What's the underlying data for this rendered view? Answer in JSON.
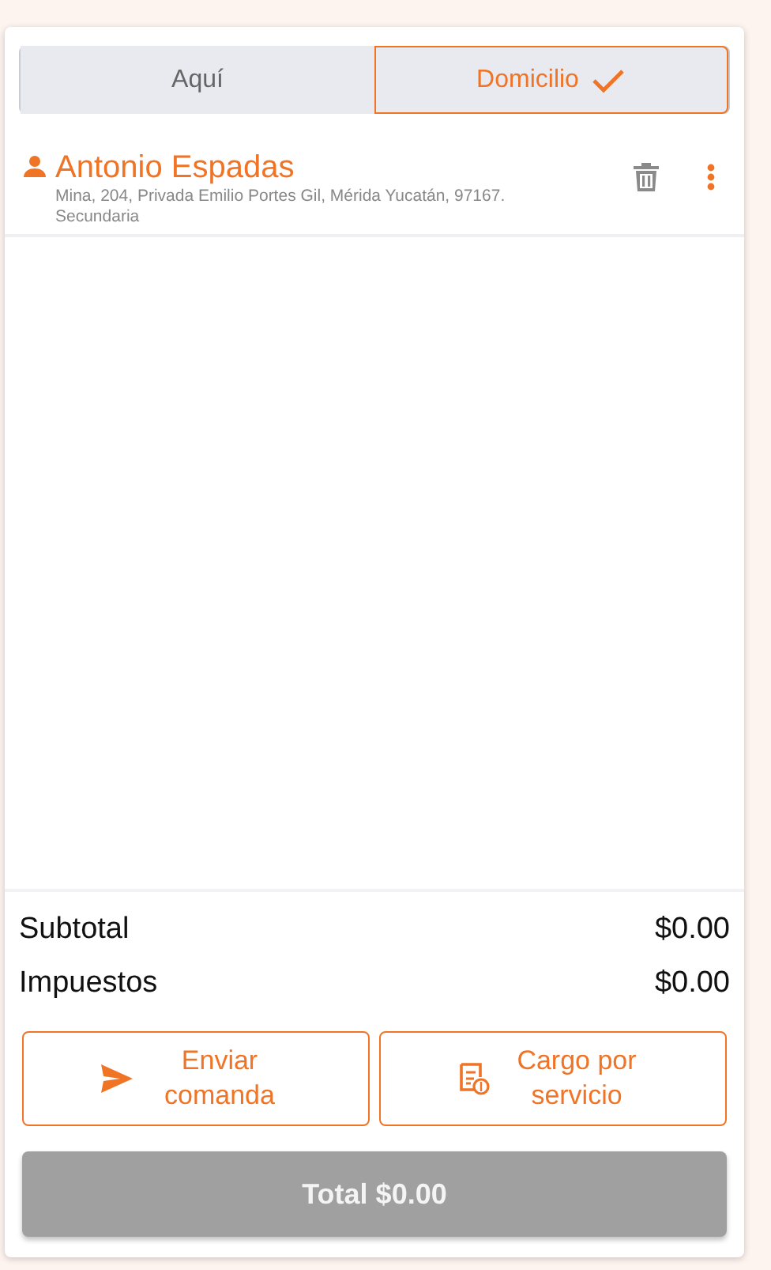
{
  "tabs": [
    {
      "label": "Aquí",
      "selected": false
    },
    {
      "label": "Domicilio",
      "selected": true
    }
  ],
  "customer": {
    "name": "Antonio Espadas",
    "address": "Mina, 204, Privada Emilio Portes Gil, Mérida Yucatán, 97167.",
    "reference": "Secundaria"
  },
  "summary": [
    {
      "label": "Subtotal",
      "value": "$0.00"
    },
    {
      "label": "Impuestos",
      "value": "$0.00"
    }
  ],
  "actions": [
    {
      "kind": "send",
      "label": "Enviar comanda"
    },
    {
      "kind": "charge",
      "label": "Cargo por servicio"
    }
  ],
  "total": {
    "label": "Total $0.00",
    "disabled": true
  }
}
